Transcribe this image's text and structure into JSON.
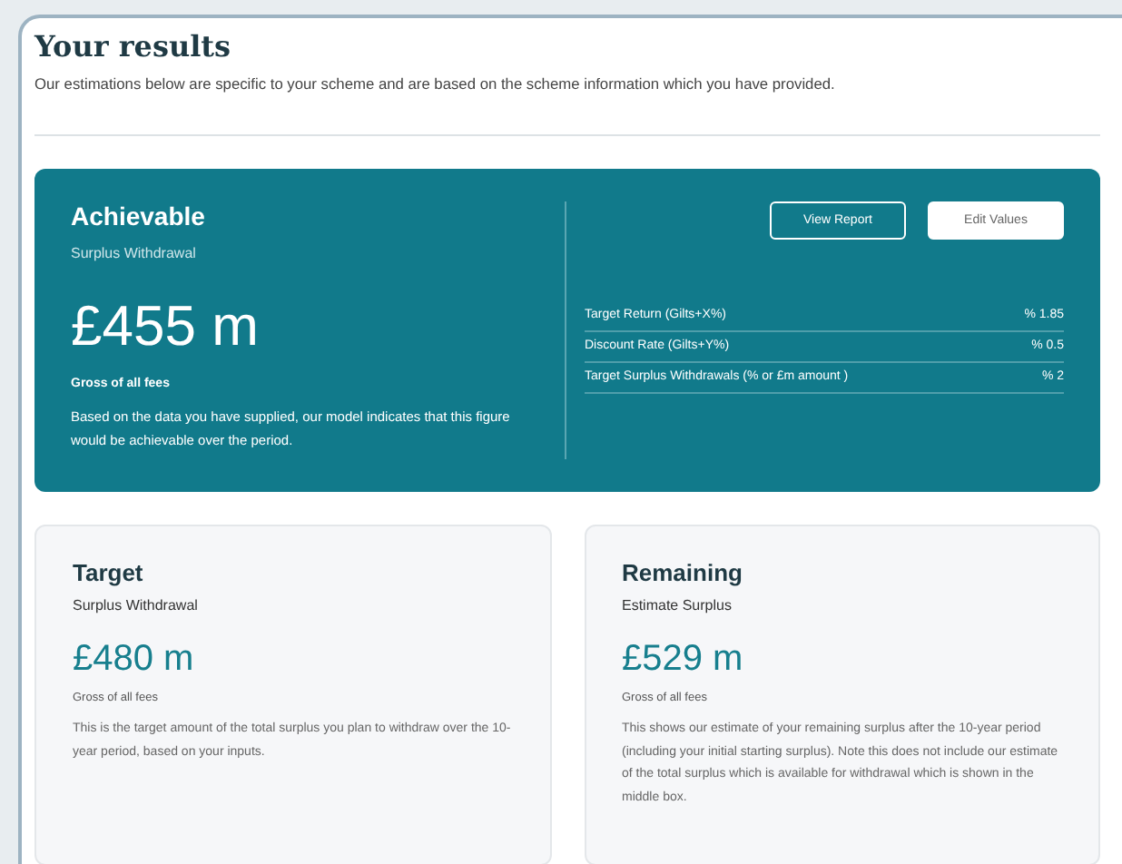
{
  "header": {
    "title": "Your results",
    "subtitle": "Our estimations below are specific to your scheme and are based on the scheme information which you have provided."
  },
  "achievable": {
    "title": "Achievable",
    "subtitle": "Surplus Withdrawal",
    "amount": "£455 m",
    "note": "Gross of all fees",
    "description": "Based on the data you have supplied, our model indicates that this figure would be achievable over the period.",
    "buttons": [
      {
        "label": "View Report",
        "kind": "outline"
      },
      {
        "label": "Edit Values",
        "kind": "solid"
      }
    ],
    "parameters": [
      {
        "label": "Target Return (Gilts+X%)",
        "value": "% 1.85"
      },
      {
        "label": "Discount Rate (Gilts+Y%)",
        "value": "% 0.5"
      },
      {
        "label": "Target Surplus Withdrawals (% or £m amount )",
        "value": "% 2"
      }
    ]
  },
  "cards": [
    {
      "title": "Target",
      "subtitle": "Surplus Withdrawal",
      "amount": "£480 m",
      "note": "Gross of all fees",
      "description": "This is the target amount of the total surplus you plan to withdraw over the 10-year period, based on your inputs."
    },
    {
      "title": "Remaining",
      "subtitle": "Estimate Surplus",
      "amount": "£529 m",
      "note": "Gross of all fees",
      "description": "This shows our estimate of your remaining surplus after the 10-year period (including your initial starting surplus). Note this does not include our estimate of the total surplus which is available for withdrawal which is shown in the middle box."
    }
  ]
}
